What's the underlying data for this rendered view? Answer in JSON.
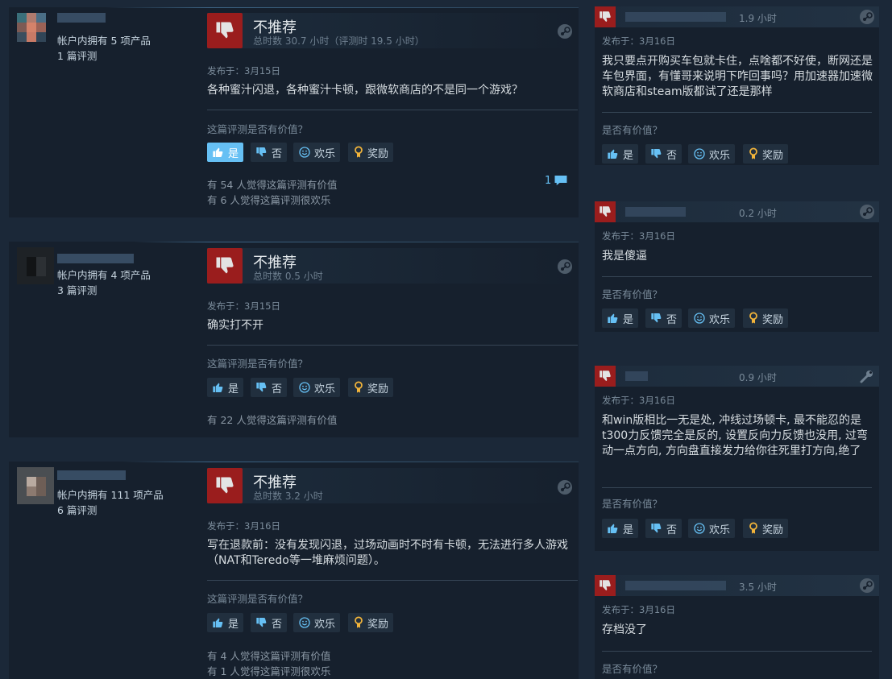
{
  "colors": {
    "background": "#1b2838",
    "card": "#16202d",
    "thumb_red": "#9a1d1d",
    "accent": "#66c0f4"
  },
  "left_reviews": [
    {
      "account_products": "帐户内拥有 5 项产品",
      "account_reviews": "1 篇评测",
      "verdict": "不推荐",
      "hours": "总时数 30.7 小时（评测时 19.5 小时）",
      "posted": "发布于：3月15日",
      "text": "各种蜜汁闪退，各种蜜汁卡顿，跟微软商店的不是同一个游戏？",
      "helpful_q": "这篇评测是否有价值？",
      "btn_yes": "是",
      "btn_no": "否",
      "btn_funny": "欢乐",
      "btn_award": "奖励",
      "stat1": "有 54 人觉得这篇评测有价值",
      "stat2": "有 6 人觉得这篇评测很欢乐",
      "comments": "1"
    },
    {
      "account_products": "帐户内拥有 4 项产品",
      "account_reviews": "3 篇评测",
      "verdict": "不推荐",
      "hours": "总时数 0.5 小时",
      "posted": "发布于：3月15日",
      "text": "确实打不开",
      "helpful_q": "这篇评测是否有价值？",
      "btn_yes": "是",
      "btn_no": "否",
      "btn_funny": "欢乐",
      "btn_award": "奖励",
      "stat1": "有 22 人觉得这篇评测有价值"
    },
    {
      "account_products": "帐户内拥有 111 项产品",
      "account_reviews": "6 篇评测",
      "verdict": "不推荐",
      "hours": "总时数 3.2 小时",
      "posted": "发布于：3月16日",
      "text": "写在退款前：没有发现闪退，过场动画时不时有卡顿，无法进行多人游戏（NAT和Teredo等一堆麻烦问题）。",
      "helpful_q": "这篇评测是否有价值？",
      "btn_yes": "是",
      "btn_no": "否",
      "btn_funny": "欢乐",
      "btn_award": "奖励",
      "stat1": "有 4 人觉得这篇评测有价值",
      "stat2": "有 1 人觉得这篇评测很欢乐"
    }
  ],
  "right_reviews": [
    {
      "hours": "1.9 小时",
      "posted": "发布于：3月16日",
      "text": "我只要点开购买车包就卡住，点啥都不好使，断网还是车包界面，有懂哥来说明下咋回事吗？用加速器加速微软商店和steam版都试了还是那样",
      "helpful_q": "是否有价值？",
      "btn_yes": "是",
      "btn_no": "否",
      "btn_funny": "欢乐",
      "btn_award": "奖励",
      "icon": "steam-icon"
    },
    {
      "hours": "0.2 小时",
      "posted": "发布于：3月16日",
      "text": "我是傻逼",
      "helpful_q": "是否有价值？",
      "btn_yes": "是",
      "btn_no": "否",
      "btn_funny": "欢乐",
      "btn_award": "奖励",
      "icon": "steam-icon"
    },
    {
      "hours": "0.9 小时",
      "posted": "发布于：3月16日",
      "text": "和win版相比一无是处, 冲线过场顿卡, 最不能忍的是t300力反馈完全是反的, 设置反向力反馈也没用, 过弯动一点方向, 方向盘直接发力给你往死里打方向,绝了",
      "helpful_q": "是否有价值？",
      "btn_yes": "是",
      "btn_no": "否",
      "btn_funny": "欢乐",
      "btn_award": "奖励",
      "icon": "wrench-icon"
    },
    {
      "hours": "3.5 小时",
      "posted": "发布于：3月16日",
      "text": "存档没了",
      "helpful_q": "是否有价值？",
      "icon": "steam-icon"
    }
  ]
}
